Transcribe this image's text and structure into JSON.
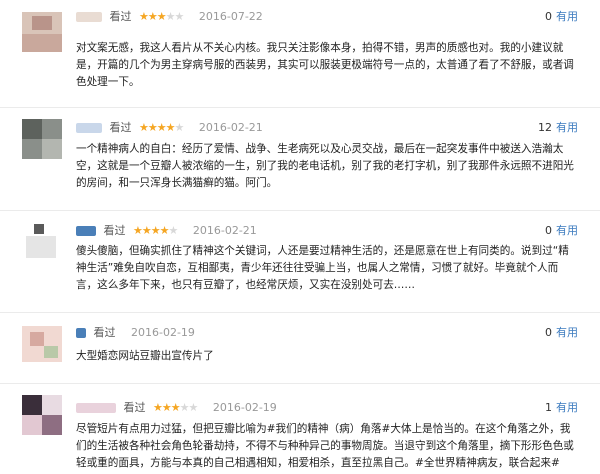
{
  "reviews": [
    {
      "seen_label": "看过",
      "rating": 3,
      "date": "2016-07-22",
      "useful_count": "0",
      "useful_label": "有用",
      "text": "对文案无感，我这人看片从不关心内核。我只关注影像本身，拍得不错，男声的质感也对。我的小建议就是，开篇的几个为男主穿病号服的西装男，其实可以服装更极端符号一点的，太普通了看了不舒服，或者调色处理一下。"
    },
    {
      "seen_label": "看过",
      "rating": 4,
      "date": "2016-02-21",
      "useful_count": "12",
      "useful_label": "有用",
      "text": "一个精神病人的自白：经历了爱情、战争、生老病死以及心灵交战，最后在一起突发事件中被送入浩瀚太空，这就是一个豆瓣人被浓缩的一生，别了我的老电话机，别了我的老打字机，别了我那件永远照不进阳光的房间，和一只浑身长满猫癣的猫。阿门。"
    },
    {
      "seen_label": "看过",
      "rating": 4,
      "date": "2016-02-21",
      "useful_count": "0",
      "useful_label": "有用",
      "text": "傻头傻脑，但确实抓住了精神这个关键词，人还是要过精神生活的，还是愿意在世上有同类的。说到过“精神生活”难免自吹自恋，互相鄙夷，青少年还往往受骗上当，也属人之常情，习惯了就好。毕竟就个人而言，这么多年下来，也只有豆瓣了，也经常厌烦，又实在没别处可去……"
    },
    {
      "seen_label": "看过",
      "rating": 0,
      "date": "2016-02-19",
      "useful_count": "0",
      "useful_label": "有用",
      "text": "大型婚恋网站豆瓣出宣传片了"
    },
    {
      "seen_label": "看过",
      "rating": 3,
      "date": "2016-02-19",
      "useful_count": "1",
      "useful_label": "有用",
      "text": "尽管短片有点用力过猛，但把豆瓣比喻为#我们的精神（病）角落#大体上是恰当的。在这个角落之外，我们的生活被各种社会角色轮番劫持，不得不与种种异己的事物周旋。当退守到这个角落里，摘下形形色色或轻或重的面具，方能与本真的自己相遇相知，相爱相杀，直至拉黑自己。#全世界精神病友，联合起来#"
    }
  ]
}
